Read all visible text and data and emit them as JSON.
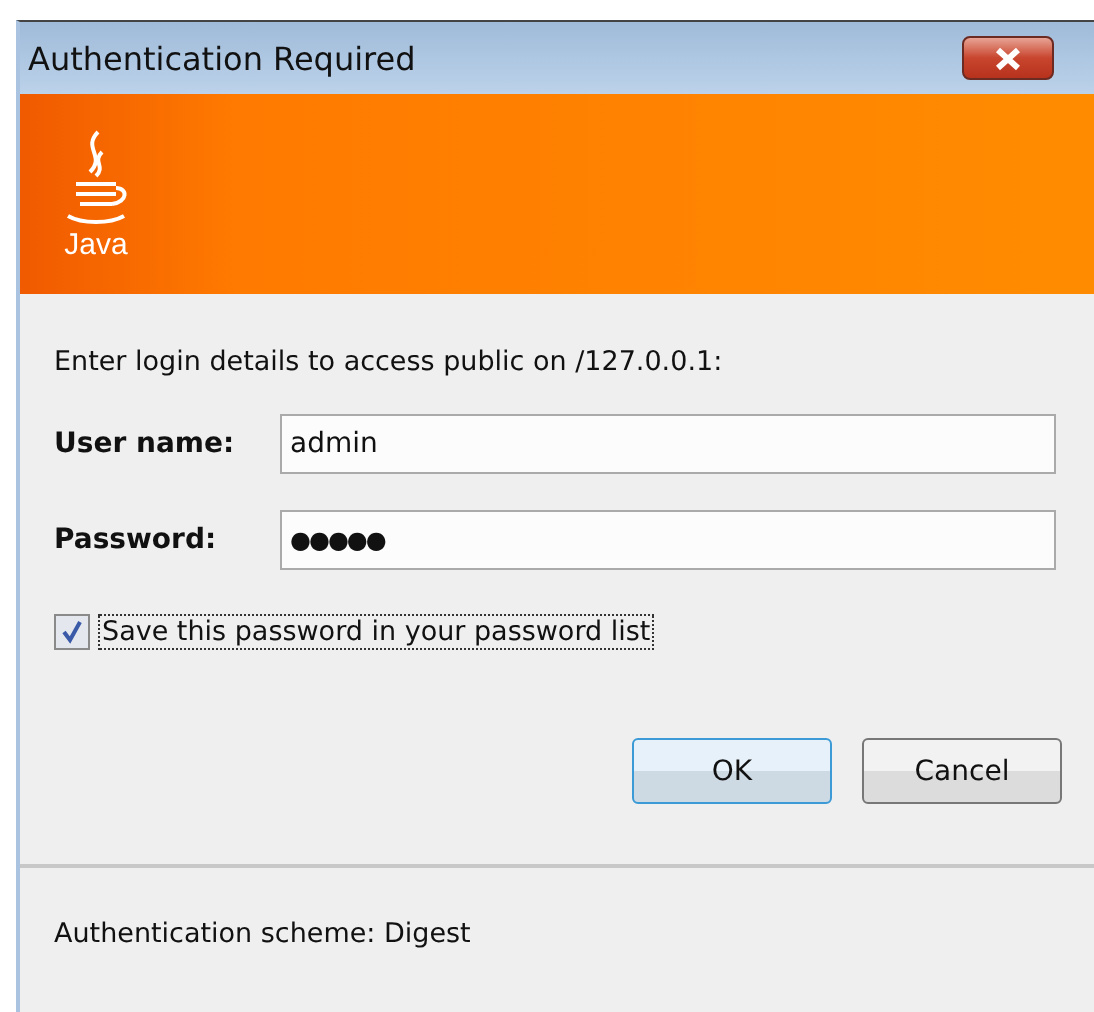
{
  "window": {
    "title": "Authentication Required"
  },
  "banner": {
    "logo_text": "Java"
  },
  "prompt": "Enter login details to access public on /127.0.0.1:",
  "fields": [
    {
      "label": "User name:",
      "value": "admin",
      "kind": "text"
    },
    {
      "label": "Password:",
      "value": "●●●●●",
      "kind": "password"
    }
  ],
  "save_password": {
    "label": "Save this password in your password list",
    "checked": true
  },
  "buttons": [
    {
      "label": "OK",
      "default": true
    },
    {
      "label": "Cancel",
      "default": false
    }
  ],
  "footer": "Authentication scheme: Digest"
}
